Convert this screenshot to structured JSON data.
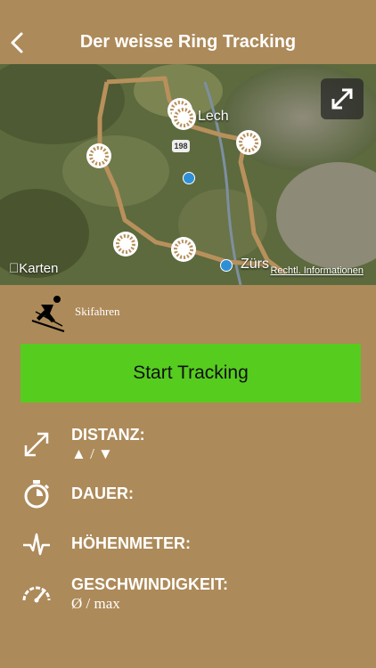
{
  "nav": {
    "title": "Der weisse Ring Tracking"
  },
  "map": {
    "attribution": "Karten",
    "legal_link": "Rechtl. Informationen",
    "place_lech": "Lech",
    "place_zurs": "Zürs",
    "road_number": "198"
  },
  "activity": {
    "label": "Skifahren"
  },
  "start_button": {
    "label": "Start Tracking"
  },
  "stats": {
    "distance": {
      "label": "DISTANZ:",
      "sub": "▲ / ▼"
    },
    "duration": {
      "label": "DAUER:"
    },
    "elevation": {
      "label": "HÖHENMETER:"
    },
    "speed": {
      "label": "GESCHWINDIGKEIT:",
      "sub": "Ø / max"
    }
  },
  "colors": {
    "background": "#ad8a59",
    "button": "#56cc1f",
    "route": "#b8905c"
  }
}
